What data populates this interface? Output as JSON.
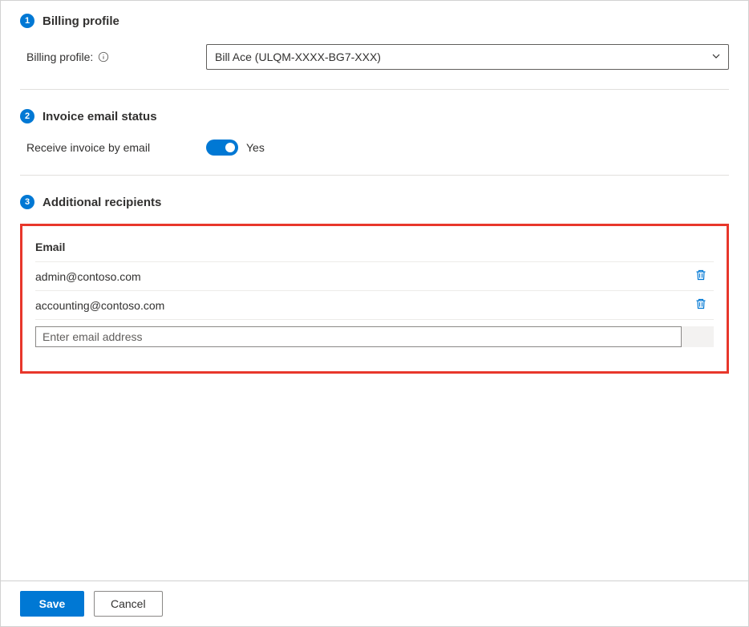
{
  "section1": {
    "stepNumber": "1",
    "title": "Billing profile",
    "fieldLabel": "Billing profile:",
    "selectedValue": "Bill Ace (ULQM-XXXX-BG7-XXX)"
  },
  "section2": {
    "stepNumber": "2",
    "title": "Invoice email status",
    "toggleLabel": "Receive invoice by email",
    "toggleValue": "Yes"
  },
  "section3": {
    "stepNumber": "3",
    "title": "Additional recipients",
    "columnHeader": "Email",
    "recipients": [
      "admin@contoso.com",
      "accounting@contoso.com"
    ],
    "inputPlaceholder": "Enter email address"
  },
  "footer": {
    "saveLabel": "Save",
    "cancelLabel": "Cancel"
  }
}
